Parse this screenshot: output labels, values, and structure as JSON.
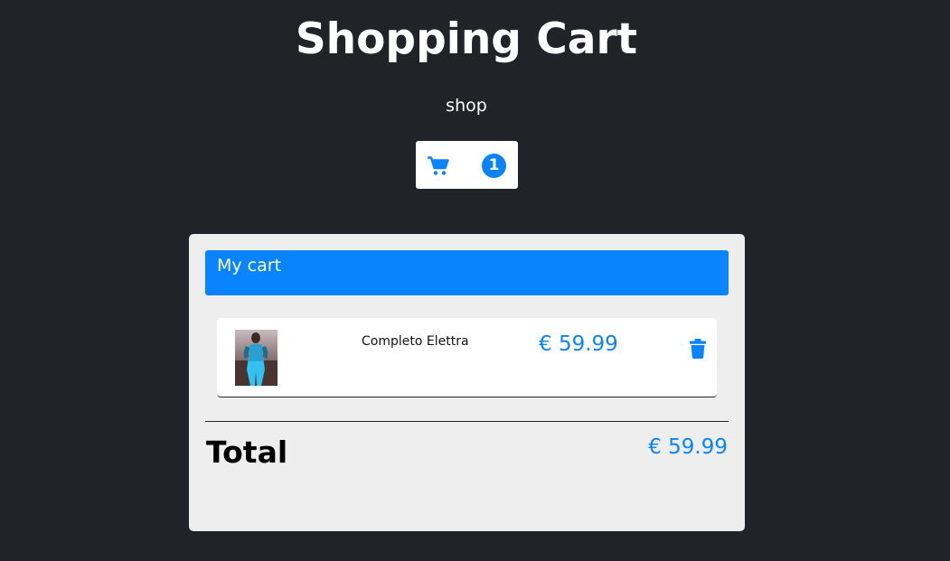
{
  "header": {
    "title": "Shopping Cart",
    "shop_link": "shop"
  },
  "cart_button": {
    "icon": "cart-icon",
    "count": "1"
  },
  "cart_panel": {
    "header_label": "My cart",
    "items": [
      {
        "name": "Completo Elettra",
        "price": "€ 59.99",
        "image": "product-photo",
        "remove_icon": "trash-icon"
      }
    ],
    "total_label": "Total",
    "total_value": "€ 59.99"
  },
  "colors": {
    "background": "#212328",
    "accent": "#0a84fc",
    "panel": "#eeeeee",
    "card": "#ffffff"
  }
}
